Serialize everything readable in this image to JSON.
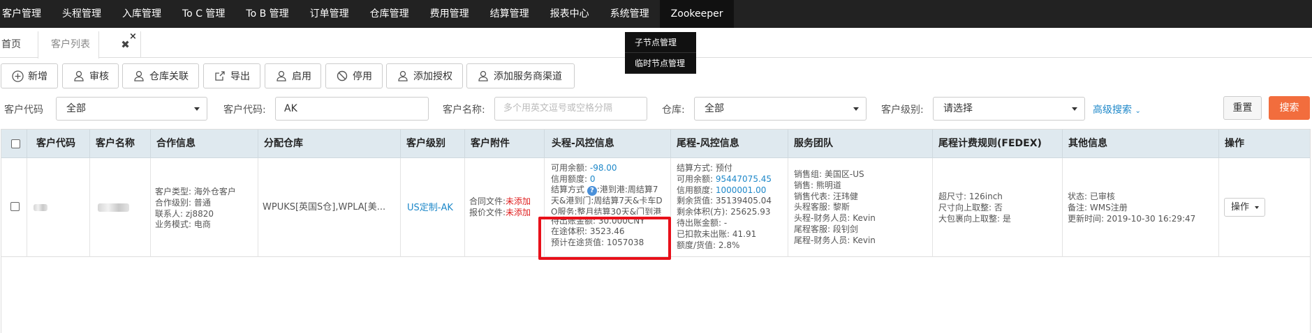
{
  "topnav": {
    "items": [
      "客户管理",
      "头程管理",
      "入库管理",
      "To C 管理",
      "To B 管理",
      "订单管理",
      "仓库管理",
      "费用管理",
      "结算管理",
      "报表中心",
      "系统管理",
      "Zookeeper"
    ],
    "active": "Zookeeper",
    "dropdown": [
      "子节点管理",
      "临时节点管理"
    ]
  },
  "tabs": {
    "home": "首页",
    "customer_list": "客户列表",
    "close": "×",
    "close_all": "✖"
  },
  "toolbar": [
    "新增",
    "审核",
    "仓库关联",
    "导出",
    "启用",
    "停用",
    "添加授权",
    "添加服务商渠道"
  ],
  "filters": {
    "code_label": "客户代码",
    "code_select": "全部",
    "code_input_label": "客户代码:",
    "code_input_value": "AK",
    "name_label": "客户名称:",
    "name_placeholder": "多个用英文逗号或空格分隔",
    "warehouse_label": "仓库:",
    "warehouse_value": "全部",
    "level_label": "客户级别:",
    "level_value": "请选择",
    "advanced": "高级搜索",
    "reset": "重置",
    "search": "搜索"
  },
  "table": {
    "headers": [
      "客户代码",
      "客户名称",
      "合作信息",
      "分配仓库",
      "客户级别",
      "客户附件",
      "头程-风控信息",
      "尾程-风控信息",
      "服务团队",
      "尾程计费规则(FEDEX)",
      "其他信息",
      "操作"
    ],
    "row": {
      "coop": [
        "客户类型: 海外仓客户",
        "合作级别: 普通",
        "联系人: zj8820",
        "业务模式: 电商"
      ],
      "warehouse": "WPUKS[英国S仓],WPLA[美...",
      "level": "US定制-AK",
      "attach": [
        {
          "label": "合同文件:",
          "status": "未添加"
        },
        {
          "label": "报价文件:",
          "status": "未添加"
        }
      ],
      "head_risk": {
        "balance_label": "可用余额:",
        "balance": "-98.00",
        "credit_label": "信用额度:",
        "credit": "0",
        "settle_label": "结算方式",
        "settle_lines": [
          ":港到港:周结算7",
          "天&港到门:周结算7天&卡车D",
          "O服务:整月结算30天&门到港"
        ],
        "pending": "待出账金额: 30.000CNY",
        "transit_volume": "在途体积: 3523.46",
        "transit_value": "预计在途货值: 1057038"
      },
      "tail_risk": {
        "settle": "结算方式: 预付",
        "balance_label": "可用余额:",
        "balance": "95447075.45",
        "credit_label": "信用额度:",
        "credit": "1000001.00",
        "stock_value": "剩余货值: 35139405.04",
        "stock_volume": "剩余体积(方): 25625.93",
        "pending": "待出账金额: -",
        "deducted": "已扣款未出账: 41.91",
        "ratio": "额度/货值: 2.8%"
      },
      "team": [
        "销售组: 美国区-US",
        "销售: 熊明道",
        "销售代表: 汪玮健",
        "头程客服: 黎斯",
        "头程-财务人员: Kevin",
        "尾程客服: 段钊剑",
        "尾程-财务人员: Kevin"
      ],
      "fedex": [
        "超尺寸: 126inch",
        "尺寸向上取整: 否",
        "大包裹向上取整: 是"
      ],
      "other": [
        "状态: 已审核",
        "备注: WMS注册",
        "更新时间: 2019-10-30 16:29:47"
      ],
      "op": "操作"
    }
  },
  "colors": {
    "nav_bg": "#222222",
    "accent_blue": "#1e88c9",
    "search_orange": "#f26d3d",
    "highlight_red": "#e8101a",
    "header_bg": "#dfe9ef"
  }
}
